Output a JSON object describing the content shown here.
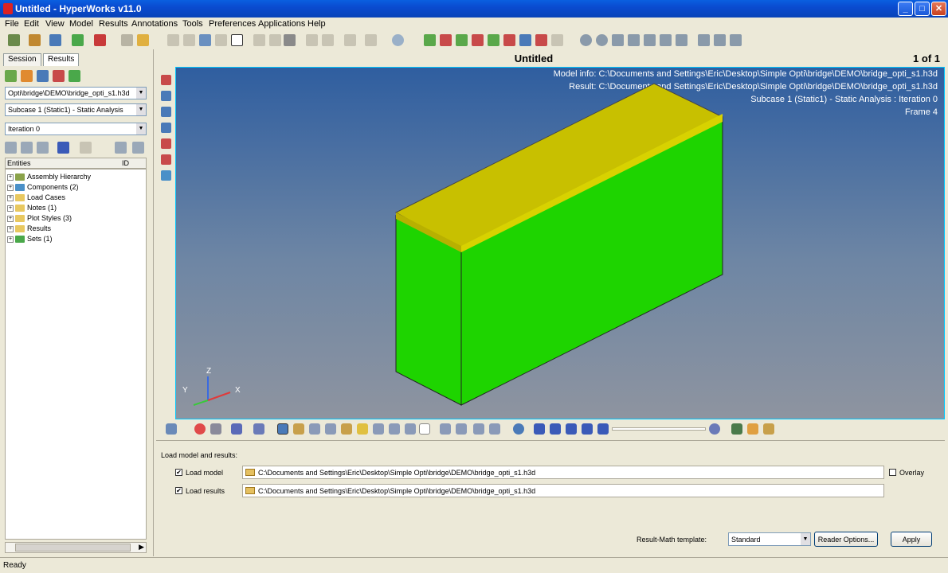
{
  "window": {
    "title": "Untitled - HyperWorks v11.0"
  },
  "menu": [
    "File",
    "Edit",
    "View",
    "Model",
    "Results",
    "Annotations",
    "Tools",
    "Preferences",
    "Applications",
    "Help"
  ],
  "left_panel": {
    "tabs": [
      "Session",
      "Results"
    ],
    "file_combo": "Opti\\bridge\\DEMO\\bridge_opti_s1.h3d",
    "subcase_combo": "Subcase 1 (Static1) - Static Analysis",
    "iteration_combo": "Iteration 0",
    "entities_header": "Entities",
    "entities_cols": [
      "ID"
    ],
    "tree": [
      {
        "label": "Assembly Hierarchy",
        "icon_color": "#8aa24a"
      },
      {
        "label": "Components (2)",
        "icon_color": "#4a90c8"
      },
      {
        "label": "Load Cases",
        "icon_color": "#e8c860"
      },
      {
        "label": "Notes (1)",
        "icon_color": "#e8c860"
      },
      {
        "label": "Plot Styles (3)",
        "icon_color": "#e8c860"
      },
      {
        "label": "Results",
        "icon_color": "#e8c860"
      },
      {
        "label": "Sets (1)",
        "icon_color": "#4aa84a"
      }
    ]
  },
  "viewport": {
    "title": "Untitled",
    "page_indicator": "1 of 1",
    "info": [
      "Model info: C:\\Documents and Settings\\Eric\\Desktop\\Simple Opti\\bridge\\DEMO\\bridge_opti_s1.h3d",
      "Result: C:\\Documents and Settings\\Eric\\Desktop\\Simple Opti\\bridge\\DEMO\\bridge_opti_s1.h3d",
      "Subcase 1 (Static1) - Static Analysis : Iteration 0",
      "Frame 4"
    ],
    "axes": {
      "x": "X",
      "y": "Y",
      "z": "Z"
    },
    "colors": {
      "model_front": "#1ed400",
      "model_top": "#c8c000"
    }
  },
  "bottom_panel": {
    "heading": "Load model and results:",
    "load_model_label": "Load model",
    "load_model_path": "C:\\Documents and Settings\\Eric\\Desktop\\Simple Opti\\bridge\\DEMO\\bridge_opti_s1.h3d",
    "load_results_label": "Load results",
    "load_results_path": "C:\\Documents and Settings\\Eric\\Desktop\\Simple Opti\\bridge\\DEMO\\bridge_opti_s1.h3d",
    "overlay_label": "Overlay",
    "template_label": "Result-Math template:",
    "template_value": "Standard",
    "reader_options_label": "Reader Options...",
    "apply_label": "Apply"
  },
  "status": "Ready"
}
